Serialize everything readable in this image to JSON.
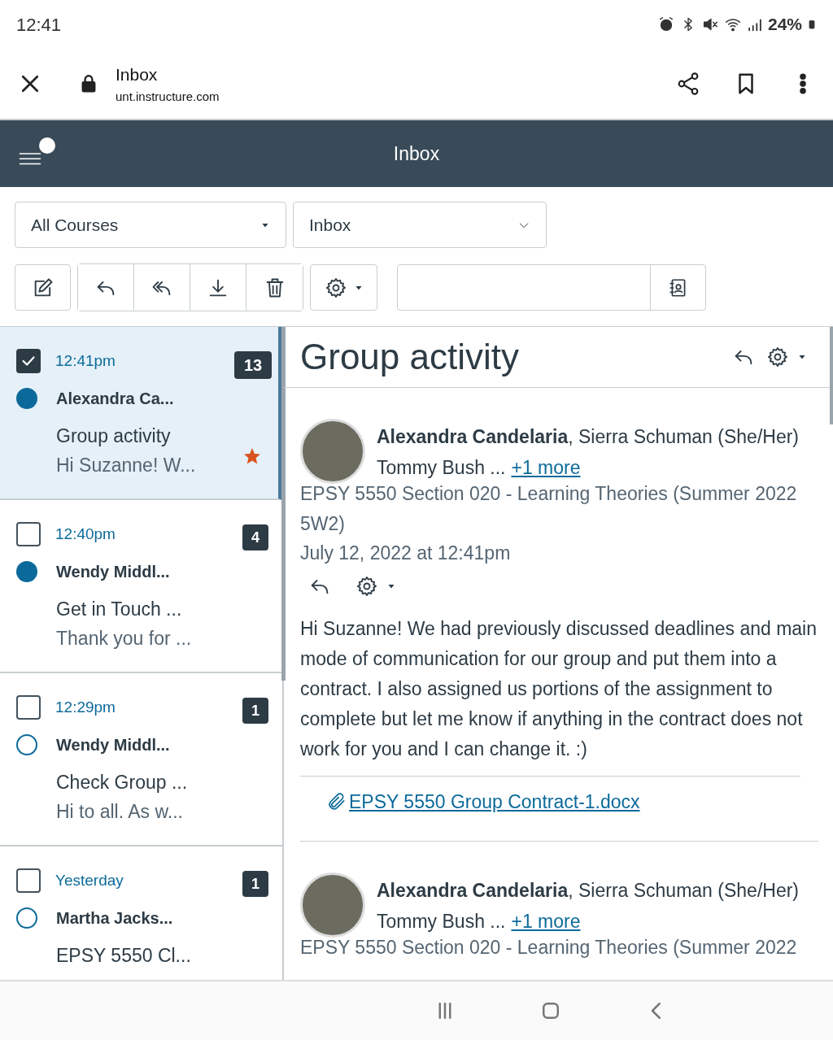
{
  "status_bar": {
    "time": "12:41",
    "battery": "24%"
  },
  "browser": {
    "title": "Inbox",
    "url": "unt.instructure.com"
  },
  "app_header": {
    "title": "Inbox",
    "notification": true
  },
  "filters": {
    "course": "All Courses",
    "mailbox": "Inbox"
  },
  "conversations": [
    {
      "time": "12:41pm",
      "count": "13",
      "sender": "Alexandra Ca...",
      "subject": "Group activity",
      "preview": "Hi Suzanne! W...",
      "checked": true,
      "selected": true,
      "unread": true,
      "starred": true
    },
    {
      "time": "12:40pm",
      "count": "4",
      "sender": "Wendy Middl...",
      "subject": "Get in Touch ...",
      "preview": "Thank you for ...",
      "checked": false,
      "selected": false,
      "unread": true,
      "starred": false
    },
    {
      "time": "12:29pm",
      "count": "1",
      "sender": "Wendy Middl...",
      "subject": "Check Group ...",
      "preview": "Hi to all. As w...",
      "checked": false,
      "selected": false,
      "unread": false,
      "starred": false
    },
    {
      "time": "Yesterday",
      "count": "1",
      "sender": "Martha Jacks...",
      "subject": "EPSY 5550 Cl...",
      "checked": false,
      "selected": false,
      "unread": false,
      "starred": false
    }
  ],
  "conversation": {
    "subject": "Group activity",
    "messages": [
      {
        "participants": "**Alexandra Candelaria**, Sierra Schuman (She/Her)",
        "participants_more": "Tommy Bush ...",
        "more_link": "+1 more",
        "course": "EPSY 5550 Section 020 - Learning Theories (Summer 2022 5W2)",
        "date": "July 12, 2022 at 12:41pm",
        "body": "Hi Suzanne! We had previously discussed deadlines and main mode of communication for our group and put them into a contract. I also assigned us portions of the assignment to complete but let me know if anything in the contract does not work for you and I can change it. :)",
        "attachment": "EPSY 5550 Group Contract-1.docx"
      },
      {
        "participants": "**Alexandra Candelaria**, Sierra Schuman (She/Her)",
        "participants_more": "Tommy Bush ...",
        "more_link": "+1 more",
        "course": "EPSY 5550 Section 020 - Learning Theories (Summer 2022"
      }
    ]
  }
}
